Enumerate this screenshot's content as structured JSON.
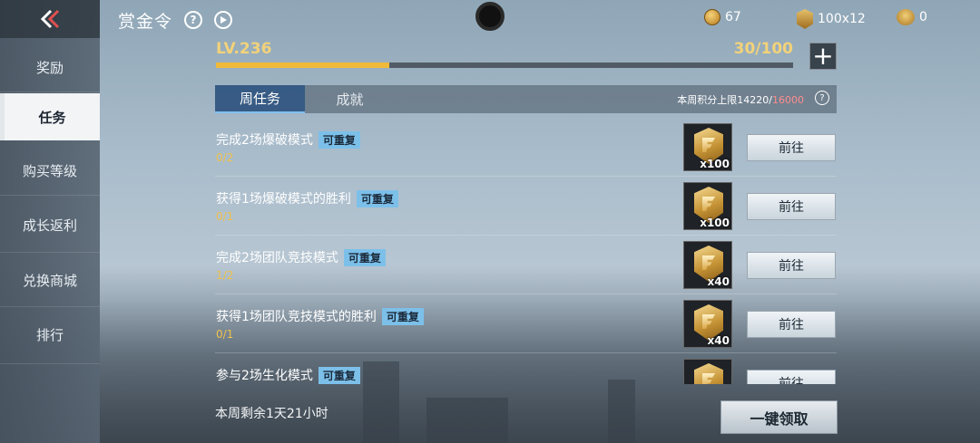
{
  "header": {
    "title": "赏金令",
    "help_icon": "question-circle-icon",
    "play_icon": "play-circle-icon"
  },
  "currencies": [
    {
      "icon": "gold-coin-icon",
      "value": "67"
    },
    {
      "icon": "gold-badge-icon",
      "value": "100x12"
    },
    {
      "icon": "ticket-icon",
      "value": "0"
    }
  ],
  "sidebar": {
    "items": [
      {
        "label": "奖励"
      },
      {
        "label": "任务"
      },
      {
        "label": "购买等级"
      },
      {
        "label": "成长返利"
      },
      {
        "label": "兑换商城"
      },
      {
        "label": "排行"
      }
    ],
    "active_index": 1
  },
  "level": {
    "label": "LV.236",
    "progress_text": "30/100",
    "progress_fraction": 0.3
  },
  "tabs": [
    {
      "label": "周任务"
    },
    {
      "label": "成就"
    }
  ],
  "weekly_limit": {
    "prefix": "本周积分上限",
    "current": "14220",
    "separator": "/",
    "max": "16000"
  },
  "tasks": [
    {
      "name": "完成2场爆破模式",
      "tag": "可重复",
      "progress": "0/2",
      "reward_qty": "x100",
      "button": "前往"
    },
    {
      "name": "获得1场爆破模式的胜利",
      "tag": "可重复",
      "progress": "0/1",
      "reward_qty": "x100",
      "button": "前往"
    },
    {
      "name": "完成2场团队竞技模式",
      "tag": "可重复",
      "progress": "1/2",
      "reward_qty": "x40",
      "button": "前往"
    },
    {
      "name": "获得1场团队竞技模式的胜利",
      "tag": "可重复",
      "progress": "0/1",
      "reward_qty": "x40",
      "button": "前往"
    },
    {
      "name": "参与2场生化模式",
      "tag": "可重复",
      "progress": "",
      "reward_qty": "",
      "button": "前往"
    }
  ],
  "footer": {
    "remaining": "本周剩余1天21小时",
    "claim_all": "一键领取"
  },
  "colors": {
    "accent_gold": "#f0b93a",
    "tab_active": "#2d5582",
    "repeat_tag": "#7cc0ea",
    "limit_max": "#ff8d8d"
  }
}
